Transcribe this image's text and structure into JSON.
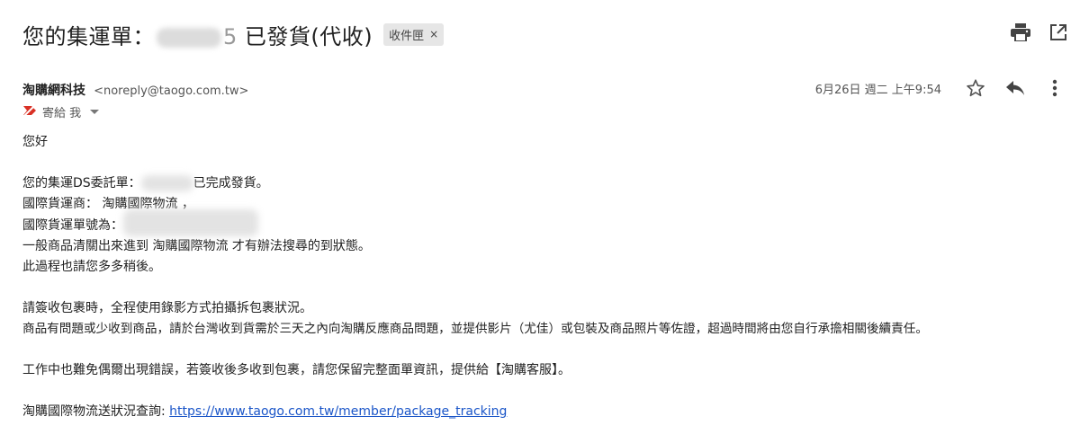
{
  "email": {
    "subject_prefix": "您的集運單：",
    "subject_suffix": "已發貨(代收)",
    "subject_tail_char": "5",
    "label": "收件匣",
    "label_close": "×",
    "sender_name": "淘購網科技",
    "sender_email": "<noreply@taogo.com.tw>",
    "date": "6月26日 週二 上午9:54",
    "to_text": "寄給 我",
    "greeting": "您好",
    "line1_prefix": "您的集運DS委託單：",
    "line1_suffix": "已完成發貨。",
    "line2": "國際貨運商： 淘購國際物流 ，",
    "line3": "國際貨運單號為：",
    "line4": "一般商品清關出來進到 淘購國際物流 才有辦法搜尋的到狀態。",
    "line5": "此過程也請您多多稍後。",
    "line6": "請簽收包裹時，全程使用錄影方式拍攝拆包裹狀況。",
    "line7": "商品有問題或少收到商品，請於台灣收到貨需於三天之內向淘購反應商品問題，並提供影片（尤佳）或包裝及商品照片等佐證，超過時間將由您自行承擔相關後續責任。",
    "line8": "工作中也難免偶爾出現錯誤，若簽收後多收到包裹，請您保留完整面單資訊，提供給【淘購客服】。",
    "tracking_label": "淘購國際物流送狀況查詢: ",
    "tracking_link": "https://www.taogo.com.tw/member/package_tracking"
  },
  "icons": {
    "print": "print-icon",
    "open_new_window": "open-in-new-window-icon",
    "star": "star-icon",
    "reply": "reply-icon",
    "more": "more-vert-icon",
    "important": "important-marker-icon"
  },
  "colors": {
    "link": "#1a55c8",
    "important_marker": "#d93025"
  }
}
